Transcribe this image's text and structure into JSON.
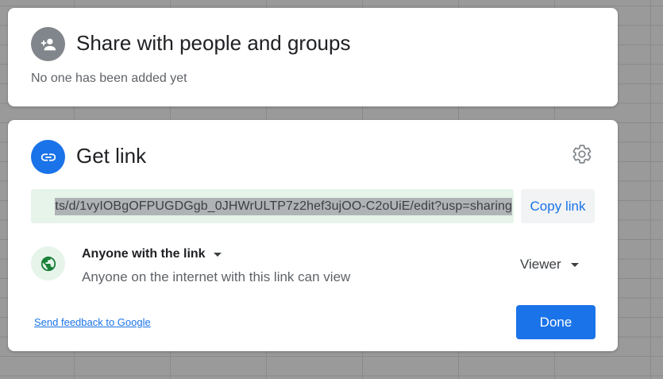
{
  "share_panel": {
    "title": "Share with people and groups",
    "empty_text": "No one has been added yet",
    "icon": "person-add-icon"
  },
  "link_panel": {
    "title": "Get link",
    "icon": "link-icon",
    "settings_icon": "gear-icon",
    "url_text": "ts/d/1vyIOBgOFPUGDGgb_0JHWrULTP7z2hef3ujOO-C2oUiE/edit?usp=sharing",
    "copy_label": "Copy link",
    "access": {
      "icon": "globe-icon",
      "title": "Anyone with the link",
      "description": "Anyone on the internet with this link can view",
      "role": "Viewer"
    },
    "feedback_label": "Send feedback to Google",
    "done_label": "Done"
  },
  "colors": {
    "accent": "#1a73e8",
    "green_bg": "#e6f4ea",
    "globe": "#188038",
    "gray_icon": "#80868b"
  }
}
